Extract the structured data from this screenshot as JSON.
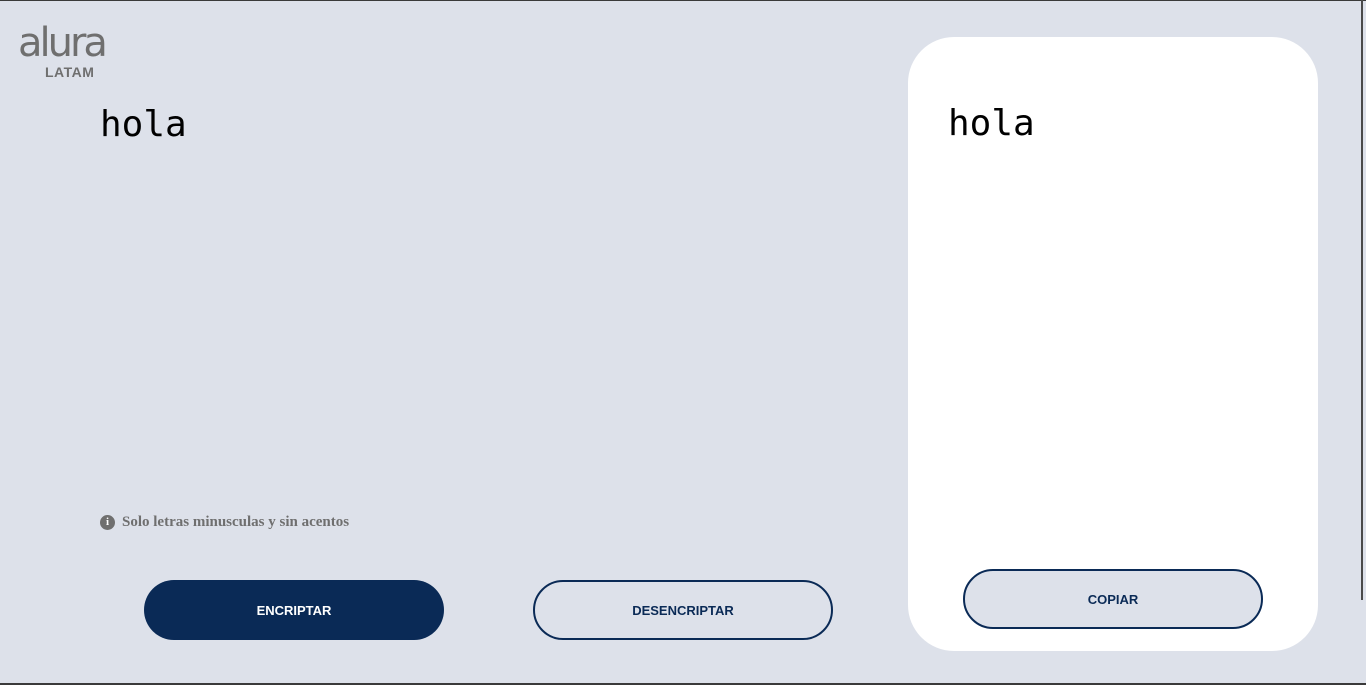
{
  "logo": {
    "main": "alura",
    "sub": "LATAM"
  },
  "input": {
    "value": "hola"
  },
  "hint": {
    "icon": "info-icon",
    "text": "Solo letras minusculas y sin acentos"
  },
  "buttons": {
    "encrypt": "ENCRIPTAR",
    "decrypt": "DESENCRIPTAR",
    "copy": "COPIAR"
  },
  "output": {
    "text": "hola"
  },
  "colors": {
    "background": "#dde1ea",
    "primary": "#0a2a56",
    "panel": "#ffffff",
    "muted": "#6f6f6f"
  }
}
